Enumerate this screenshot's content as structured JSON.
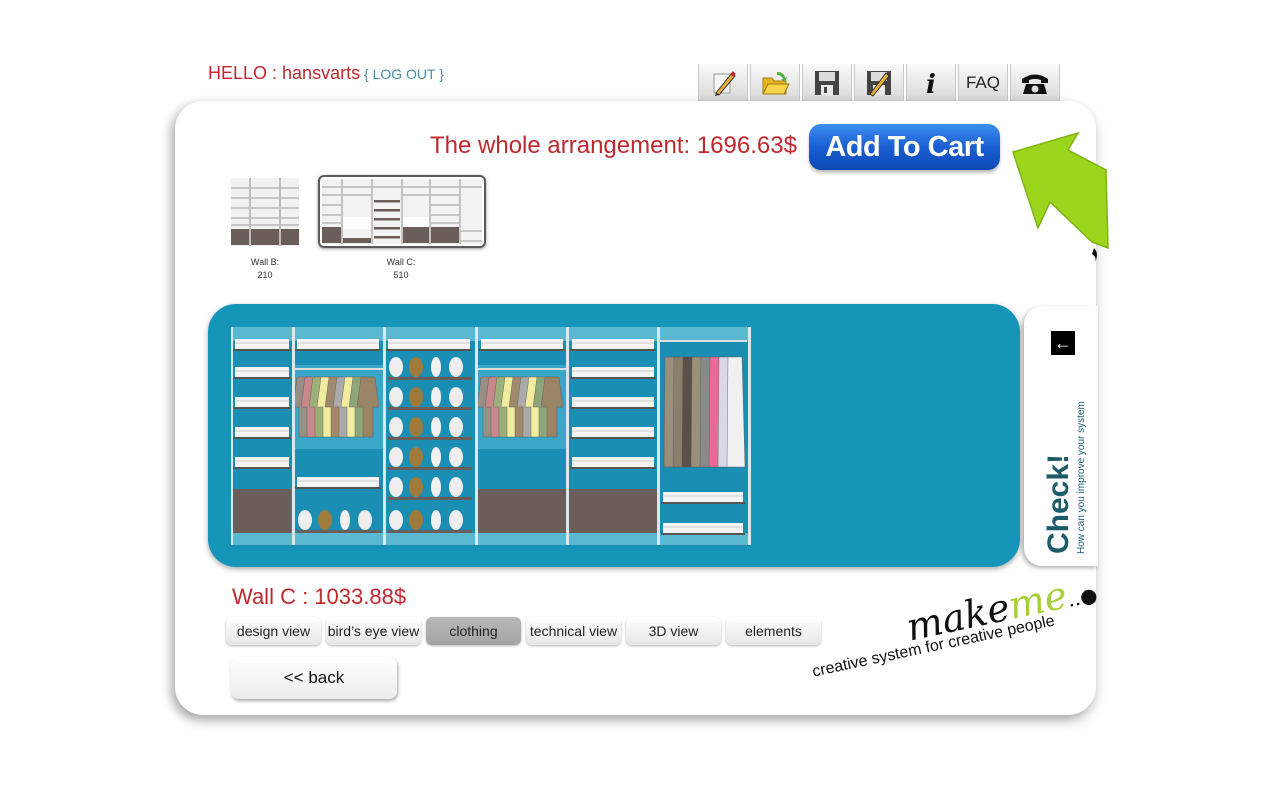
{
  "header": {
    "greeting": "HELLO : hansvarts",
    "logout": "{ LOG OUT }",
    "toolbar": [
      {
        "icon": "pencil-edit-icon",
        "label": "Edit"
      },
      {
        "icon": "folder-open-icon",
        "label": "Open"
      },
      {
        "icon": "save-disk-icon",
        "label": "Save"
      },
      {
        "icon": "save-as-icon",
        "label": "Save as"
      },
      {
        "icon": "info-icon",
        "label": "i"
      },
      {
        "icon": "faq-icon",
        "label": "FAQ"
      },
      {
        "icon": "phone-icon",
        "label": "Contact"
      }
    ]
  },
  "summary": {
    "total_label": "The whole arrangement: 1696.63$",
    "add_to_cart": "Add To Cart"
  },
  "walls": [
    {
      "name": "Wall B:",
      "width": "210",
      "selected": false
    },
    {
      "name": "Wall C:",
      "width": "510",
      "selected": true
    }
  ],
  "check_panel": {
    "arrow": "←",
    "title": "Check!",
    "subtitle": "How can you improve your system"
  },
  "current_wall": {
    "price_label": "Wall C : 1033.88$"
  },
  "view_tabs": [
    {
      "label": "design view",
      "active": false
    },
    {
      "label": "bird’s eye view",
      "active": false
    },
    {
      "label": "clothing",
      "active": true
    },
    {
      "label": "technical view",
      "active": false
    },
    {
      "label": "3D view",
      "active": false
    },
    {
      "label": "elements",
      "active": false
    }
  ],
  "back_button": "<< back",
  "logo": {
    "make": "make",
    "me": "me",
    "dots": "..●",
    "tagline": "creative system for creative people"
  },
  "colors": {
    "accent_red": "#c0282d",
    "stage_blue": "#1596b9",
    "cart_blue": "#1a5fd2",
    "arrow_green": "#9cd61c"
  }
}
